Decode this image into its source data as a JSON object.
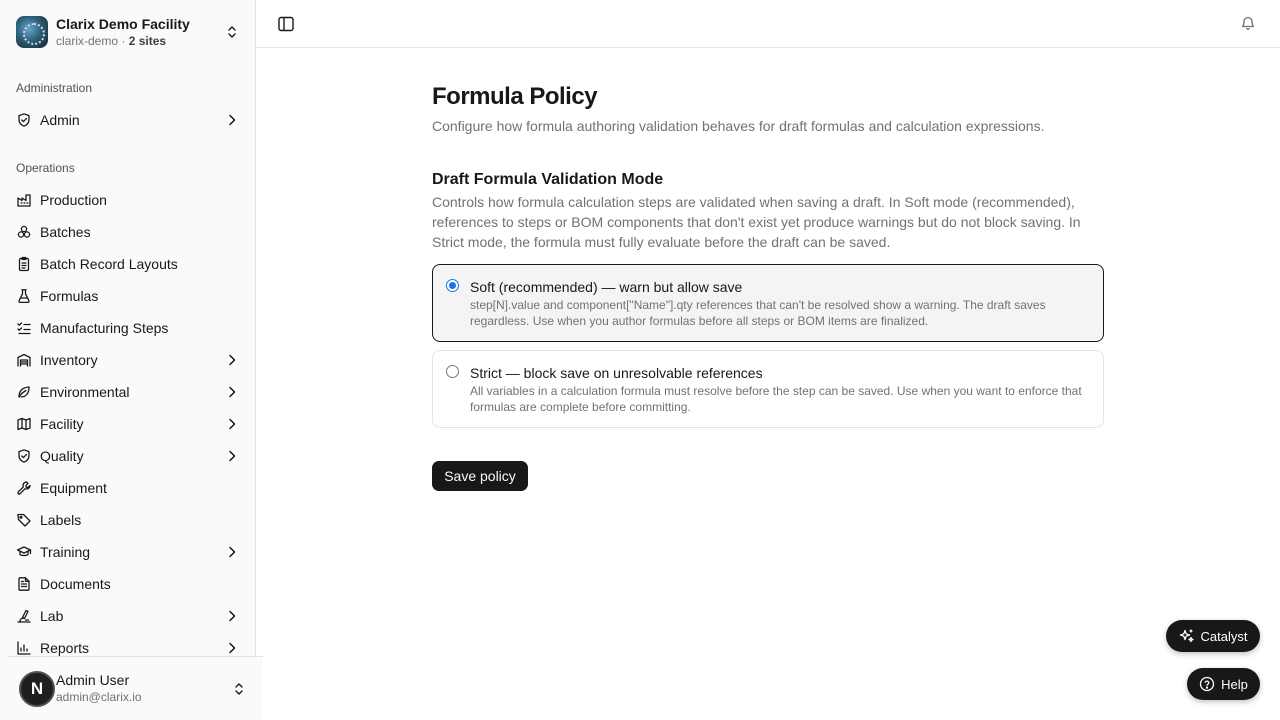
{
  "org": {
    "name": "Clarix Demo Facility",
    "slug": "clarix-demo",
    "separator": " · ",
    "sites": "2 sites"
  },
  "sidebar": {
    "administration_label": "Administration",
    "operations_label": "Operations",
    "admin_items": [
      {
        "label": "Admin",
        "icon": "shield-check-icon",
        "has_submenu": true
      }
    ],
    "operations_items": [
      {
        "label": "Production",
        "icon": "factory-icon",
        "has_submenu": false
      },
      {
        "label": "Batches",
        "icon": "boxes-icon",
        "has_submenu": false
      },
      {
        "label": "Batch Record Layouts",
        "icon": "clipboard-list-icon",
        "has_submenu": false
      },
      {
        "label": "Formulas",
        "icon": "flask-icon",
        "has_submenu": false
      },
      {
        "label": "Manufacturing Steps",
        "icon": "list-checks-icon",
        "has_submenu": false
      },
      {
        "label": "Inventory",
        "icon": "warehouse-icon",
        "has_submenu": true
      },
      {
        "label": "Environmental",
        "icon": "leaf-icon",
        "has_submenu": true
      },
      {
        "label": "Facility",
        "icon": "map-icon",
        "has_submenu": true
      },
      {
        "label": "Quality",
        "icon": "shield-check-icon",
        "has_submenu": true
      },
      {
        "label": "Equipment",
        "icon": "wrench-icon",
        "has_submenu": false
      },
      {
        "label": "Labels",
        "icon": "tag-icon",
        "has_submenu": false
      },
      {
        "label": "Training",
        "icon": "graduation-cap-icon",
        "has_submenu": true
      },
      {
        "label": "Documents",
        "icon": "file-text-icon",
        "has_submenu": false
      },
      {
        "label": "Lab",
        "icon": "microscope-icon",
        "has_submenu": true
      },
      {
        "label": "Reports",
        "icon": "bar-chart-icon",
        "has_submenu": true
      }
    ]
  },
  "user": {
    "initial": "N",
    "name": "Admin User",
    "email": "admin@clarix.io"
  },
  "main": {
    "title": "Formula Policy",
    "description": "Configure how formula authoring validation behaves for draft formulas and calculation expressions.",
    "section_title": "Draft Formula Validation Mode",
    "section_description": "Controls how formula calculation steps are validated when saving a draft. In Soft mode (recommended), references to steps or BOM components that don't exist yet produce warnings but do not block saving. In Strict mode, the formula must fully evaluate before the draft can be saved.",
    "options": [
      {
        "title": "Soft (recommended) — warn but allow save",
        "description": "step[N].value and component[\"Name\"].qty references that can't be resolved show a warning. The draft saves regardless. Use when you author formulas before all steps or BOM items are finalized.",
        "selected": true
      },
      {
        "title": "Strict — block save on unresolvable references",
        "description": "All variables in a calculation formula must resolve before the step can be saved. Use when you want to enforce that formulas are complete before committing.",
        "selected": false
      }
    ],
    "save_label": "Save policy"
  },
  "floating": {
    "catalyst_label": "Catalyst",
    "help_label": "Help"
  },
  "colors": {
    "accent": "#18181b",
    "radio": "#1a73e8",
    "muted_text": "#71717a",
    "border": "#e4e4e7"
  }
}
